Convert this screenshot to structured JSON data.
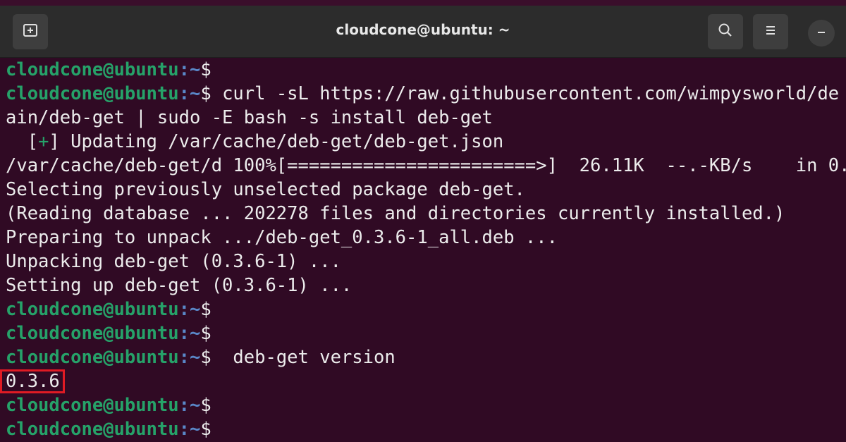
{
  "window": {
    "title": "cloudcone@ubuntu: ~",
    "icons": {
      "new_tab": "new-tab-icon",
      "search": "search-icon",
      "menu": "hamburger-menu-icon",
      "minimize": "minimize-icon"
    }
  },
  "colors": {
    "background": "#300a24",
    "prompt": "#26a269",
    "highlight_box": "#e01b24"
  },
  "terminal": {
    "prompt_user": "cloudcone@ubuntu",
    "prompt_path": ":~",
    "prompt_symbol": "$",
    "lines": {
      "l1_cmd": "",
      "l2_cmd": " curl -sL https://raw.githubusercontent.com/wimpysworld/de",
      "l3": "ain/deb-get | sudo -E bash -s install deb-get",
      "l4_pre": "  [",
      "l4_plus": "+",
      "l4_post": "] Updating /var/cache/deb-get/deb-get.json",
      "l5": "/var/cache/deb-get/d 100%[=======================>]  26.11K  --.-KB/s    in 0.",
      "l6": "Selecting previously unselected package deb-get.",
      "l7": "(Reading database ... 202278 files and directories currently installed.)",
      "l8": "Preparing to unpack .../deb-get_0.3.6-1_all.deb ...",
      "l9": "Unpacking deb-get (0.3.6-1) ...",
      "l10": "Setting up deb-get (0.3.6-1) ...",
      "l13_cmd": "  deb-get version",
      "l14_output": "0.3.6"
    }
  }
}
